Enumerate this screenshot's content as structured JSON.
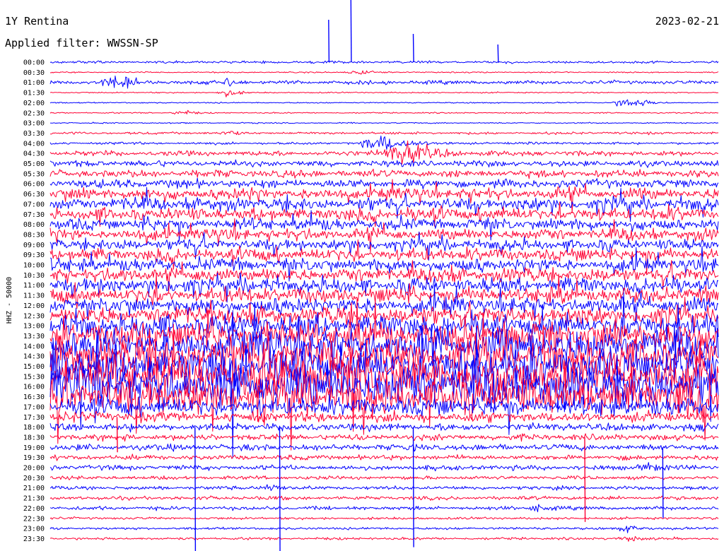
{
  "header": {
    "station": "1Y Rentina",
    "date": "2023-02-21",
    "filter": "Applied filter: WWSSN-SP"
  },
  "colors": {
    "trace_a": "#0000ff",
    "trace_b": "#ff0033",
    "background": "#ffffff",
    "text": "#000000"
  },
  "chart_data": {
    "type": "line",
    "subtype": "helicorder",
    "title": "1Y Rentina",
    "ylabel": "HHZ - 50000",
    "grid": false,
    "legend": "none",
    "rows": [
      "00:00",
      "00:30",
      "01:00",
      "01:30",
      "02:00",
      "02:30",
      "03:00",
      "03:30",
      "04:00",
      "04:30",
      "05:00",
      "05:30",
      "06:00",
      "06:30",
      "07:00",
      "07:30",
      "08:00",
      "08:30",
      "09:00",
      "09:30",
      "10:00",
      "10:30",
      "11:00",
      "11:30",
      "12:00",
      "12:30",
      "13:00",
      "13:30",
      "14:00",
      "14:30",
      "15:00",
      "15:30",
      "16:00",
      "16:30",
      "17:00",
      "17:30",
      "18:00",
      "18:30",
      "19:00",
      "19:30",
      "20:00",
      "20:30",
      "21:00",
      "21:30",
      "22:00",
      "22:30",
      "23:00",
      "23:30"
    ],
    "row_duration_minutes": 30,
    "series": [
      {
        "color": "#0000ff",
        "amplitude_by_row": [
          2,
          1,
          3,
          1,
          1,
          1,
          1,
          1,
          2,
          4,
          5,
          6,
          7,
          9,
          10,
          10,
          9,
          9,
          9,
          10,
          10,
          11,
          12,
          12,
          12,
          14,
          18,
          22,
          26,
          28,
          30,
          32,
          34,
          30,
          14,
          8,
          6,
          5,
          5,
          4,
          4,
          3,
          3,
          3,
          3,
          2,
          2,
          2
        ]
      },
      {
        "color": "#ff0033",
        "amplitude_by_row": [
          2,
          1,
          3,
          1,
          1,
          1,
          1,
          2,
          2,
          4,
          5,
          6,
          7,
          9,
          10,
          10,
          9,
          9,
          9,
          10,
          10,
          11,
          12,
          12,
          12,
          14,
          18,
          22,
          26,
          28,
          30,
          32,
          34,
          30,
          14,
          8,
          6,
          5,
          5,
          4,
          4,
          3,
          3,
          3,
          3,
          2,
          2,
          2
        ]
      }
    ],
    "events": [
      {
        "row": "01:00",
        "minute": 3,
        "amplitude": 18,
        "duration_minutes": 2
      },
      {
        "row": "01:00",
        "minute": 8,
        "amplitude": 8,
        "duration_minutes": 1.5
      },
      {
        "row": "01:30",
        "minute": 8,
        "amplitude": 6,
        "duration_minutes": 1.5
      },
      {
        "row": "00:30",
        "minute": 14,
        "amplitude": 5,
        "duration_minutes": 2
      },
      {
        "row": "02:00",
        "minute": 26,
        "amplitude": 10,
        "duration_minutes": 2
      },
      {
        "row": "02:30",
        "minute": 6,
        "amplitude": 5,
        "duration_minutes": 1.5
      },
      {
        "row": "03:30",
        "minute": 8,
        "amplitude": 6,
        "duration_minutes": 1.5
      },
      {
        "row": "04:00",
        "minute": 15,
        "amplitude": 14,
        "duration_minutes": 3
      },
      {
        "row": "04:30",
        "minute": 16,
        "amplitude": 18,
        "duration_minutes": 4
      },
      {
        "row": "20:00",
        "minute": 27,
        "amplitude": 8,
        "duration_minutes": 2.5
      },
      {
        "row": "20:00",
        "minute": 22,
        "amplitude": 5,
        "duration_minutes": 1.5
      },
      {
        "row": "21:00",
        "minute": 10,
        "amplitude": 7,
        "duration_minutes": 2
      },
      {
        "row": "22:00",
        "minute": 22,
        "amplitude": 6,
        "duration_minutes": 2.5
      },
      {
        "row": "23:00",
        "minute": 26,
        "amplitude": 6,
        "duration_minutes": 2
      },
      {
        "row": "23:30",
        "minute": 26,
        "amplitude": 5,
        "duration_minutes": 2
      }
    ],
    "spikes": [
      {
        "row": "00:00",
        "minute": 12.5,
        "up": 60,
        "down": 0
      },
      {
        "row": "00:00",
        "minute": 13.5,
        "up": 90,
        "down": 0
      },
      {
        "row": "00:00",
        "minute": 16.3,
        "up": 40,
        "down": 0
      },
      {
        "row": "00:00",
        "minute": 20.1,
        "up": 25,
        "down": 0
      },
      {
        "row": "17:30",
        "minute": 3,
        "up": 0,
        "down": 50
      },
      {
        "row": "18:00",
        "minute": 6.5,
        "up": 0,
        "down": 180
      },
      {
        "row": "18:00",
        "minute": 10.3,
        "up": 0,
        "down": 190
      },
      {
        "row": "18:00",
        "minute": 16.3,
        "up": 0,
        "down": 170
      },
      {
        "row": "18:30",
        "minute": 24,
        "up": 0,
        "down": 120
      },
      {
        "row": "19:00",
        "minute": 27.5,
        "up": 0,
        "down": 100
      }
    ]
  }
}
